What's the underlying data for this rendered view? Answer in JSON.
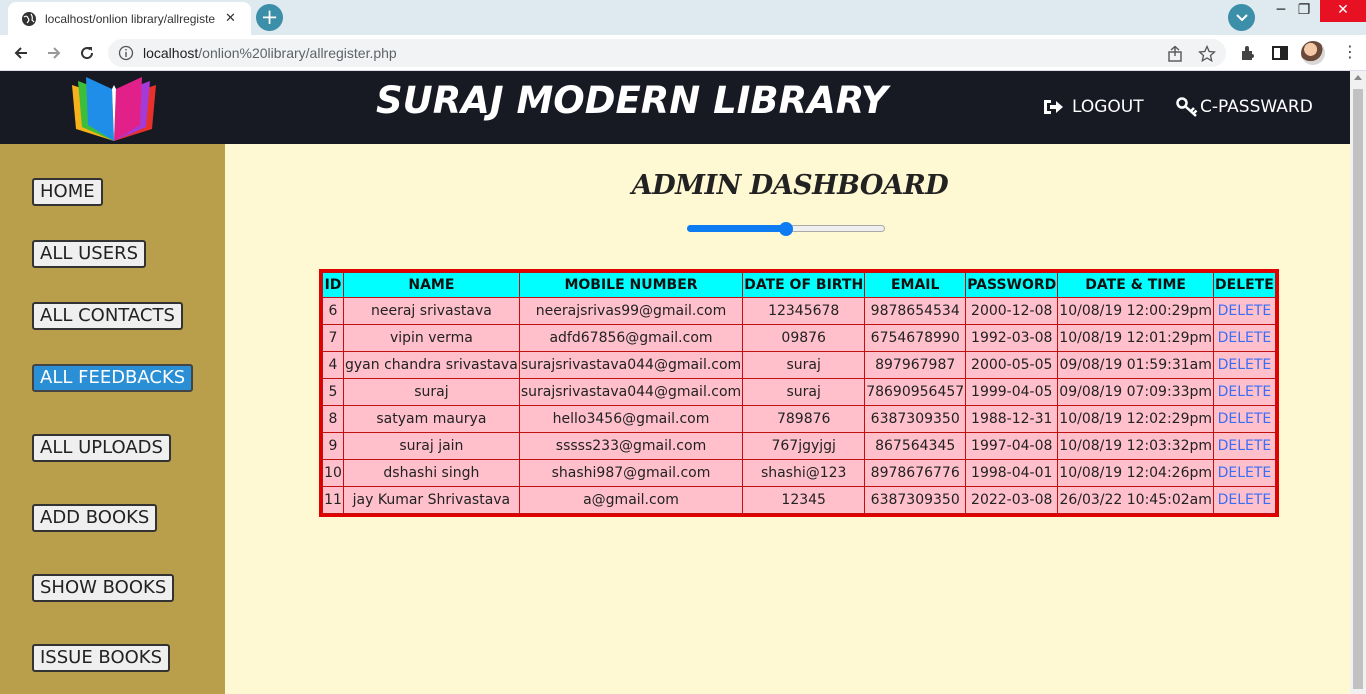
{
  "browser": {
    "tab_title": "localhost/onlion library/allregiste",
    "close_glyph": "✕",
    "newtab_glyph": "+",
    "url_host": "localhost",
    "url_path": "/onlion%20library/allregister.php",
    "win_minimize": "─",
    "win_maximize": "❐",
    "win_close": "✕",
    "menu_glyph": "⋮",
    "icons": [
      "globe-icon",
      "back-arrow-icon",
      "forward-arrow-icon",
      "reload-icon",
      "info-icon",
      "share-icon",
      "star-icon",
      "extensions-icon",
      "sidepanel-icon",
      "avatar"
    ]
  },
  "header": {
    "title": "SURAJ MODERN LIBRARY",
    "logout_label": "LOGOUT",
    "change_password_label": "C-PASSWARD"
  },
  "sidebar": {
    "items": [
      {
        "label": "HOME"
      },
      {
        "label": "ALL USERS"
      },
      {
        "label": "ALL CONTACTS"
      },
      {
        "label": "ALL FEEDBACKS",
        "active": true
      },
      {
        "label": "ALL UPLOADS"
      },
      {
        "label": "ADD BOOKS"
      },
      {
        "label": "SHOW BOOKS"
      },
      {
        "label": "ISSUE BOOKS"
      }
    ]
  },
  "main": {
    "title": "ADMIN DASHBOARD",
    "slider_value_percent": 50
  },
  "table": {
    "columns": [
      "ID",
      "NAME",
      "MOBILE NUMBER",
      "DATE OF BIRTH",
      "EMAIL",
      "PASSWORD",
      "DATE & TIME",
      "DELETE"
    ],
    "rows": [
      [
        "6",
        "neeraj srivastava",
        "neerajsrivas99@gmail.com",
        "12345678",
        "9878654534",
        "2000-12-08",
        "10/08/19 12:00:29pm",
        "DELETE"
      ],
      [
        "7",
        "vipin verma",
        "adfd67856@gmail.com",
        "09876",
        "6754678990",
        "1992-03-08",
        "10/08/19 12:01:29pm",
        "DELETE"
      ],
      [
        "4",
        "gyan chandra srivastava",
        "surajsrivastava044@gmail.com",
        "suraj",
        "897967987",
        "2000-05-05",
        "09/08/19 01:59:31am",
        "DELETE"
      ],
      [
        "5",
        "suraj",
        "surajsrivastava044@gmail.com",
        "suraj",
        "78690956457",
        "1999-04-05",
        "09/08/19 07:09:33pm",
        "DELETE"
      ],
      [
        "8",
        "satyam maurya",
        "hello3456@gmail.com",
        "789876",
        "6387309350",
        "1988-12-31",
        "10/08/19 12:02:29pm",
        "DELETE"
      ],
      [
        "9",
        "suraj jain",
        "sssss233@gmail.com",
        "767jgyjgj",
        "867564345",
        "1997-04-08",
        "10/08/19 12:03:32pm",
        "DELETE"
      ],
      [
        "10",
        "dshashi singh",
        "shashi987@gmail.com",
        "shashi@123",
        "8978676776",
        "1998-04-01",
        "10/08/19 12:04:26pm",
        "DELETE"
      ],
      [
        "11",
        "jay Kumar Shrivastava",
        "a@gmail.com",
        "12345",
        "6387309350",
        "2022-03-08",
        "26/03/22 10:45:02am",
        "DELETE"
      ]
    ]
  },
  "colors": {
    "header_bg": "#171923",
    "sidebar_bg": "#b99f4c",
    "main_bg": "#fff9d3",
    "table_header_bg": "#00ffff",
    "table_row_bg": "#ffc0cb",
    "table_border": "#e00000",
    "link": "#3a6ef5",
    "active_button": "#2a8fd4"
  }
}
